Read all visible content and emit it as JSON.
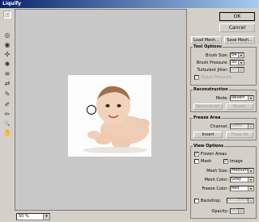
{
  "window": {
    "title": "Liquify"
  },
  "toolbar": {
    "tools": [
      {
        "name": "forward-warp-tool",
        "glyph": "☝"
      },
      {
        "name": "twirl-clockwise-tool",
        "glyph": "◎"
      },
      {
        "name": "twirl-counterclockwise-tool",
        "glyph": "◉"
      },
      {
        "name": "pucker-tool",
        "glyph": "✣"
      },
      {
        "name": "bloat-tool",
        "glyph": "✺"
      },
      {
        "name": "shift-pixels-tool",
        "glyph": "≋"
      },
      {
        "name": "reflection-tool",
        "glyph": "⇄"
      },
      {
        "name": "reconstruct-tool",
        "glyph": "✎"
      },
      {
        "name": "freeze-mask-tool",
        "glyph": "✐"
      },
      {
        "name": "thaw-mask-tool",
        "glyph": "✏"
      },
      {
        "name": "zoom-tool",
        "glyph": "🔍"
      },
      {
        "name": "hand-tool",
        "glyph": "✋"
      }
    ]
  },
  "status": {
    "zoom": "50 %",
    "zoom_arrow": "▾"
  },
  "buttons": {
    "ok": "OK",
    "cancel": "Cancel",
    "load_mesh": "Load Mesh...",
    "save_mesh": "Save Mesh..."
  },
  "tool_options": {
    "title": "Tool Options",
    "brush_size_label": "Brush Size:",
    "brush_size": "64",
    "brush_pressure_label": "Brush Pressure:",
    "brush_pressure": "50",
    "turbulent_jitter_label": "Turbulent Jitter:",
    "turbulent_jitter": "50",
    "stylus_pressure_label": "Stylus Pressure"
  },
  "reconstruction": {
    "title": "Reconstruction",
    "mode_label": "Mode:",
    "mode": "Revert",
    "reconstruct": "Reconstruct",
    "revert": "Revert"
  },
  "freeze_area": {
    "title": "Freeze Area",
    "channel_label": "Channel:",
    "channel": "None",
    "invert": "Invert",
    "thaw_all": "Thaw All"
  },
  "view_options": {
    "title": "View Options",
    "frozen_areas": "Frozen Areas",
    "frozen_checked": "✓",
    "mesh": "Mesh",
    "image": "Image",
    "image_checked": "✓",
    "mesh_size_label": "Mesh Size:",
    "mesh_size": "Medium",
    "mesh_color_label": "Mesh Color:",
    "mesh_color": "Gray",
    "freeze_color_label": "Freeze Color:",
    "freeze_color": "Red",
    "backdrop": "Backdrop:",
    "backdrop_value": "All Layers",
    "opacity_label": "Opacity:",
    "opacity": "50"
  },
  "dropdown_arrow": "▾"
}
